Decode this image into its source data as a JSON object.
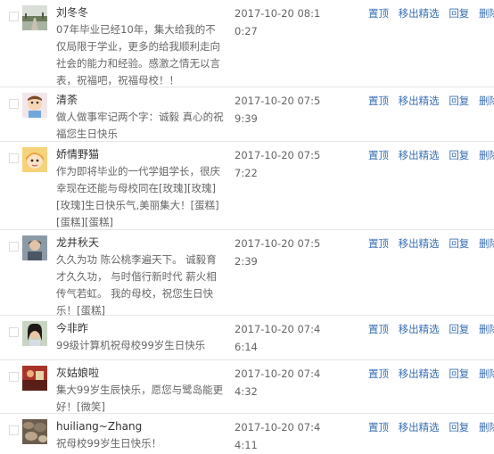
{
  "actions": {
    "pin": "置顶",
    "unfeature": "移出精选",
    "reply": "回复",
    "delete": "删除"
  },
  "comments": [
    {
      "name": "刘冬冬",
      "text": "07年毕业已经10年，集大给我的不仅局限于学业，更多的给我顺利走向社会的能力和经验。感激之情无以言表，祝福吧，祝福母校！！",
      "time": "2017-10-20 08:10:27",
      "avatar": "landscape-road"
    },
    {
      "name": "清荼",
      "text": "做人做事牢记两个字：诚毅 真心的祝福您生日快乐",
      "time": "2017-10-20 07:59:39",
      "avatar": "cartoon-character"
    },
    {
      "name": "娇情野猫",
      "text": "作为即将毕业的一代学姐学长，很庆幸现在还能与母校同在[玫瑰][玫瑰][玫瑰]生日快乐气,美丽集大！[蛋糕][蛋糕][蛋糕]",
      "time": "2017-10-20 07:57:22",
      "avatar": "anime-girl"
    },
    {
      "name": "龙井秋天",
      "text": "久久为功 陈公桃李遍天下。 诚毅育才久久功， 与时偕行新时代 薪火相传气若虹。 我的母校，祝您生日快乐！[蛋糕]",
      "time": "2017-10-20 07:52:39",
      "avatar": "portrait-photo"
    },
    {
      "name": "今非昨",
      "text": "99级计算机祝母校99岁生日快乐",
      "time": "2017-10-20 07:46:14",
      "avatar": "person-dark-hair"
    },
    {
      "name": "灰姑娘啦",
      "text": "集大99岁生辰快乐，愿您与鹭岛能更好！[微笑]",
      "time": "2017-10-20 07:44:32",
      "avatar": "red-scene"
    },
    {
      "name": "huiliang~Zhang",
      "text": "祝母校99岁生日快乐！",
      "time": "2017-10-20 07:44:11",
      "avatar": "pebbles"
    }
  ]
}
